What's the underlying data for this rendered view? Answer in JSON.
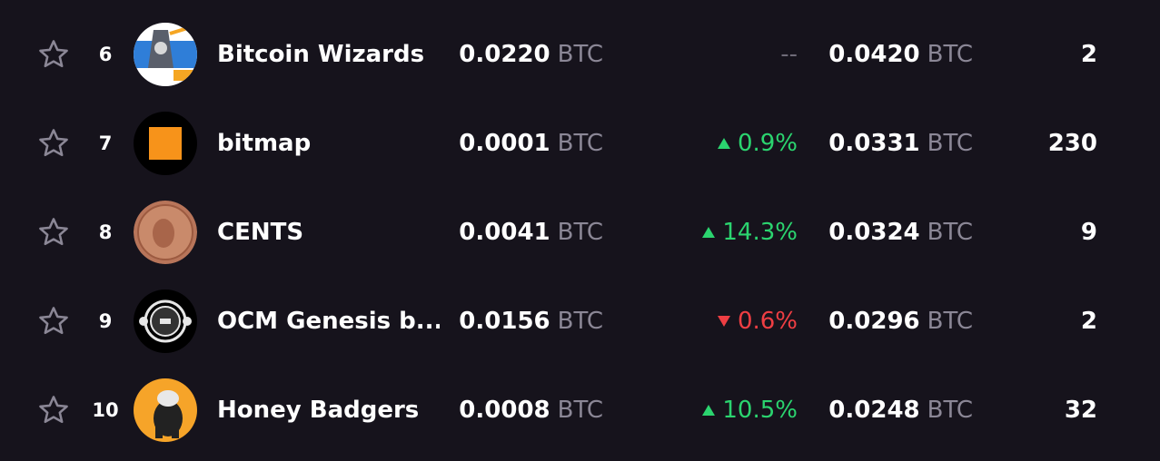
{
  "unit": "BTC",
  "rows": [
    {
      "rank": "6",
      "name": "Bitcoin Wizards",
      "price": "0.0220",
      "change": "--",
      "change_dir": "none",
      "volume": "0.0420",
      "owners": "2",
      "avatar_icon": "wizard-avatar-icon"
    },
    {
      "rank": "7",
      "name": "bitmap",
      "price": "0.0001",
      "change": "0.9%",
      "change_dir": "up",
      "volume": "0.0331",
      "owners": "230",
      "avatar_icon": "orange-square-avatar-icon"
    },
    {
      "rank": "8",
      "name": "CENTS",
      "price": "0.0041",
      "change": "14.3%",
      "change_dir": "up",
      "volume": "0.0324",
      "owners": "9",
      "avatar_icon": "penny-coin-avatar-icon"
    },
    {
      "rank": "9",
      "name": "OCM Genesis b...",
      "price": "0.0156",
      "change": "0.6%",
      "change_dir": "down",
      "volume": "0.0296",
      "owners": "2",
      "avatar_icon": "ocm-logo-avatar-icon"
    },
    {
      "rank": "10",
      "name": "Honey Badgers",
      "price": "0.0008",
      "change": "10.5%",
      "change_dir": "up",
      "volume": "0.0248",
      "owners": "32",
      "avatar_icon": "honey-badger-avatar-icon"
    }
  ],
  "colors": {
    "background": "#16131c",
    "up": "#2bd46f",
    "down": "#ef3e43",
    "muted": "#8b8796"
  }
}
